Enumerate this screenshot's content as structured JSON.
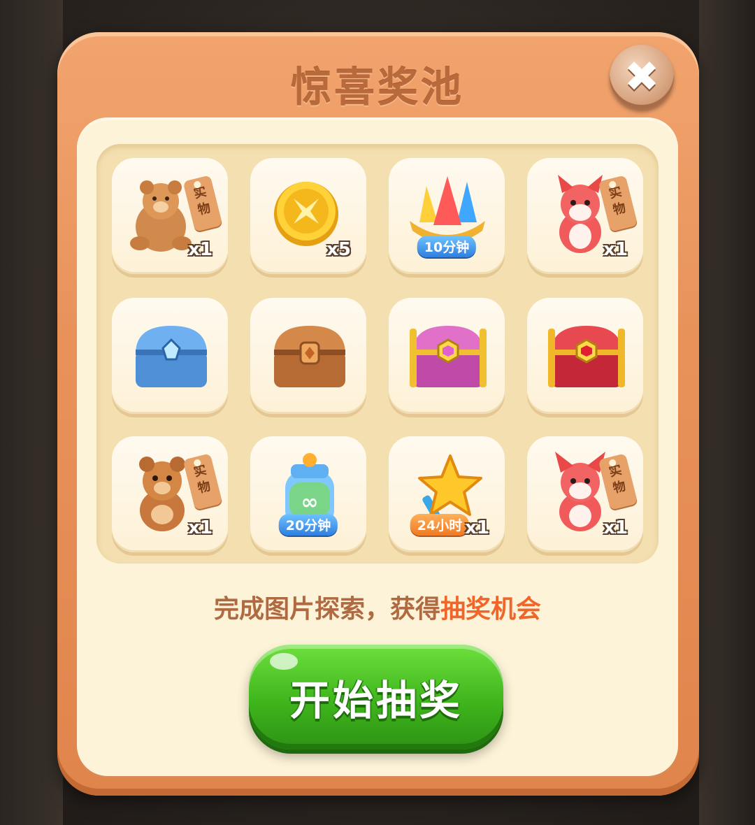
{
  "dialog": {
    "title": "惊喜奖池",
    "close_symbol": "✖",
    "hint_prefix": "完成图片探索，获得",
    "hint_highlight": "抽奖机会",
    "start_label": "开始抽奖"
  },
  "colors": {
    "frame": "#e8925a",
    "panel": "#fdf3d8",
    "accent": "#f0652a",
    "button": "#3fb51c"
  },
  "prizes": [
    {
      "icon": "teddy-bear-icon",
      "qty": "x1",
      "tag_line1": "实",
      "tag_line2": "物"
    },
    {
      "icon": "gold-coin-icon",
      "qty": "x5"
    },
    {
      "icon": "rocket-booster-icon",
      "timer": "10分钟"
    },
    {
      "icon": "red-fox-plush-icon",
      "qty": "x1",
      "tag_line1": "实",
      "tag_line2": "物"
    },
    {
      "icon": "blue-chest-icon"
    },
    {
      "icon": "wooden-chest-icon"
    },
    {
      "icon": "purple-chest-icon"
    },
    {
      "icon": "red-chest-icon"
    },
    {
      "icon": "brown-bear-plush-icon",
      "qty": "x1",
      "tag_line1": "实",
      "tag_line2": "物"
    },
    {
      "icon": "infinite-bottle-icon",
      "timer": "20分钟"
    },
    {
      "icon": "gold-star-icon",
      "timer": "24小时",
      "qty": "x1"
    },
    {
      "icon": "fox-plush-icon",
      "qty": "x1",
      "tag_line1": "实",
      "tag_line2": "物"
    }
  ]
}
